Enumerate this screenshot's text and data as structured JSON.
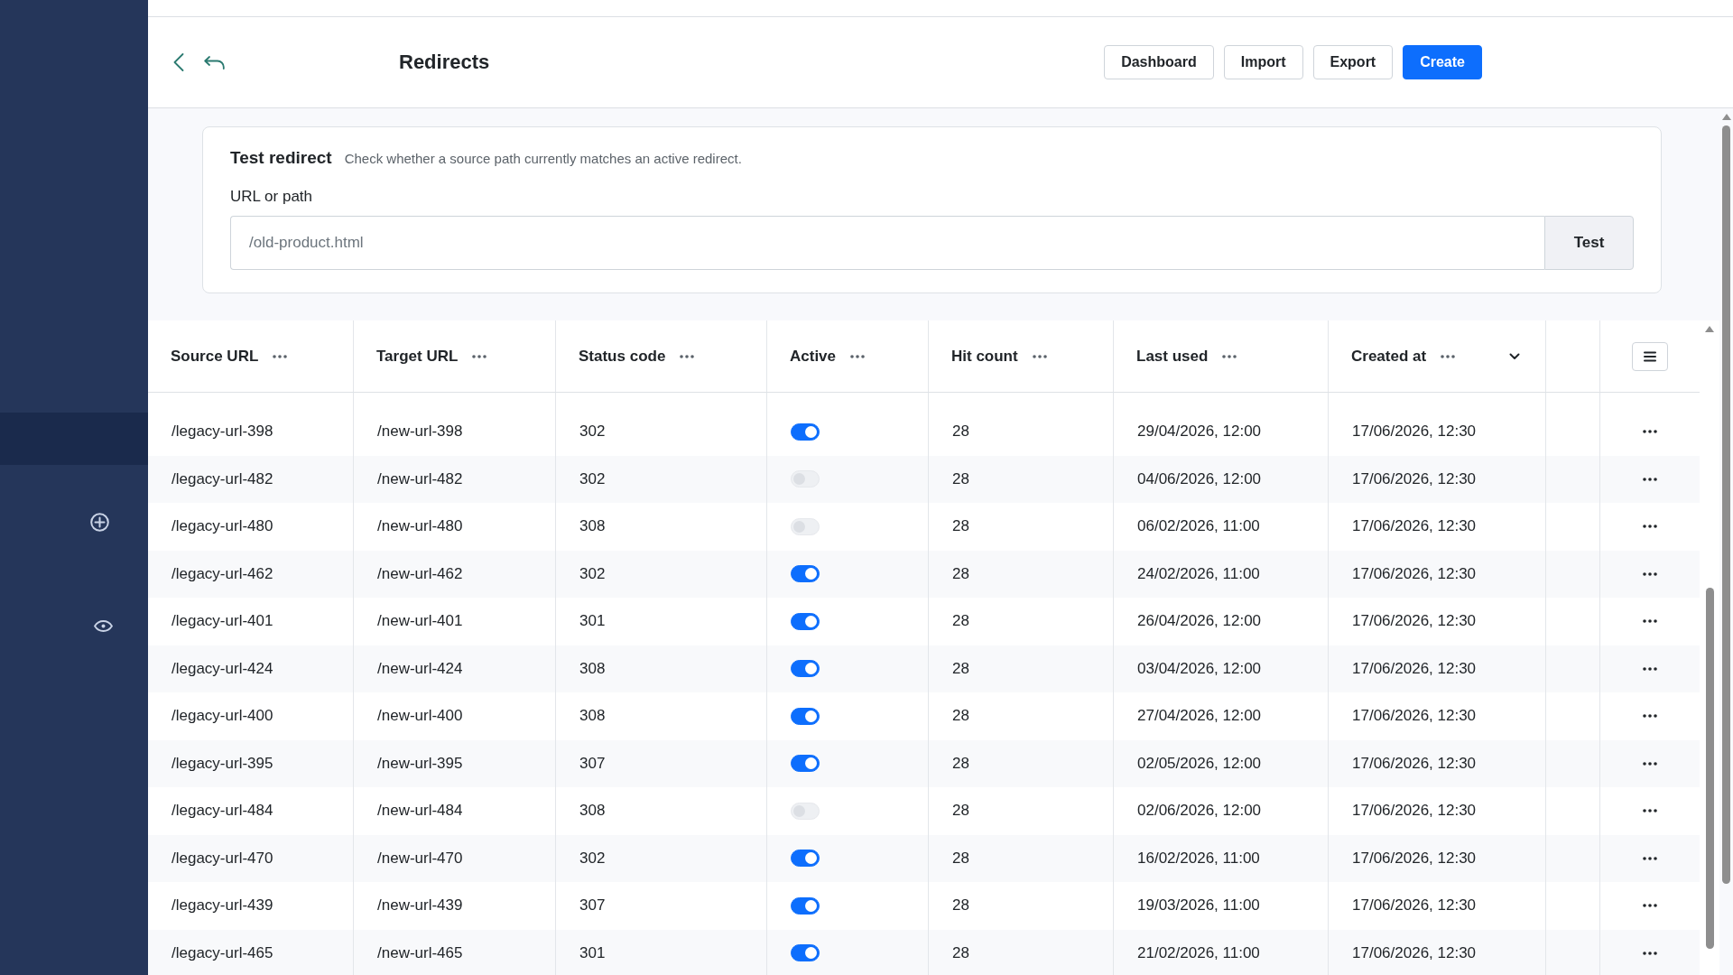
{
  "sidebar": {
    "items": [
      {
        "kind": "blank",
        "selected": true
      },
      {
        "kind": "add",
        "selected": false
      },
      {
        "kind": "view",
        "selected": false
      }
    ]
  },
  "header": {
    "title": "Redirects",
    "actions": [
      {
        "label": "Dashboard",
        "kind": "secondary"
      },
      {
        "label": "Import",
        "kind": "secondary"
      },
      {
        "label": "Export",
        "kind": "secondary"
      },
      {
        "label": "Create",
        "kind": "primary"
      }
    ]
  },
  "test_redirect": {
    "title": "Test redirect",
    "description": "Check whether a source path currently matches an active redirect.",
    "field_label": "URL or path",
    "input": {
      "placeholder": "/old-product.html"
    },
    "button": "Test"
  },
  "table": {
    "columns": [
      {
        "label": "Source URL",
        "sorted": false
      },
      {
        "label": "Target URL",
        "sorted": false
      },
      {
        "label": "Status code",
        "sorted": false
      },
      {
        "label": "Active",
        "sorted": false
      },
      {
        "label": "Hit count",
        "sorted": false
      },
      {
        "label": "Last used",
        "sorted": false
      },
      {
        "label": "Created at",
        "sorted": true
      }
    ],
    "rows": [
      {
        "source": "/legacy-url-398",
        "target": "/new-url-398",
        "status": "302",
        "active": true,
        "hits": "28",
        "last_used": "29/04/2026, 12:00",
        "created_at": "17/06/2026, 12:30"
      },
      {
        "source": "/legacy-url-482",
        "target": "/new-url-482",
        "status": "302",
        "active": false,
        "hits": "28",
        "last_used": "04/06/2026, 12:00",
        "created_at": "17/06/2026, 12:30"
      },
      {
        "source": "/legacy-url-480",
        "target": "/new-url-480",
        "status": "308",
        "active": false,
        "hits": "28",
        "last_used": "06/02/2026, 11:00",
        "created_at": "17/06/2026, 12:30"
      },
      {
        "source": "/legacy-url-462",
        "target": "/new-url-462",
        "status": "302",
        "active": true,
        "hits": "28",
        "last_used": "24/02/2026, 11:00",
        "created_at": "17/06/2026, 12:30"
      },
      {
        "source": "/legacy-url-401",
        "target": "/new-url-401",
        "status": "301",
        "active": true,
        "hits": "28",
        "last_used": "26/04/2026, 12:00",
        "created_at": "17/06/2026, 12:30"
      },
      {
        "source": "/legacy-url-424",
        "target": "/new-url-424",
        "status": "308",
        "active": true,
        "hits": "28",
        "last_used": "03/04/2026, 12:00",
        "created_at": "17/06/2026, 12:30"
      },
      {
        "source": "/legacy-url-400",
        "target": "/new-url-400",
        "status": "308",
        "active": true,
        "hits": "28",
        "last_used": "27/04/2026, 12:00",
        "created_at": "17/06/2026, 12:30"
      },
      {
        "source": "/legacy-url-395",
        "target": "/new-url-395",
        "status": "307",
        "active": true,
        "hits": "28",
        "last_used": "02/05/2026, 12:00",
        "created_at": "17/06/2026, 12:30"
      },
      {
        "source": "/legacy-url-484",
        "target": "/new-url-484",
        "status": "308",
        "active": false,
        "hits": "28",
        "last_used": "02/06/2026, 12:00",
        "created_at": "17/06/2026, 12:30"
      },
      {
        "source": "/legacy-url-470",
        "target": "/new-url-470",
        "status": "302",
        "active": true,
        "hits": "28",
        "last_used": "16/02/2026, 11:00",
        "created_at": "17/06/2026, 12:30"
      },
      {
        "source": "/legacy-url-439",
        "target": "/new-url-439",
        "status": "307",
        "active": true,
        "hits": "28",
        "last_used": "19/03/2026, 11:00",
        "created_at": "17/06/2026, 12:30"
      },
      {
        "source": "/legacy-url-465",
        "target": "/new-url-465",
        "status": "301",
        "active": true,
        "hits": "28",
        "last_used": "21/02/2026, 11:00",
        "created_at": "17/06/2026, 12:30"
      }
    ]
  }
}
